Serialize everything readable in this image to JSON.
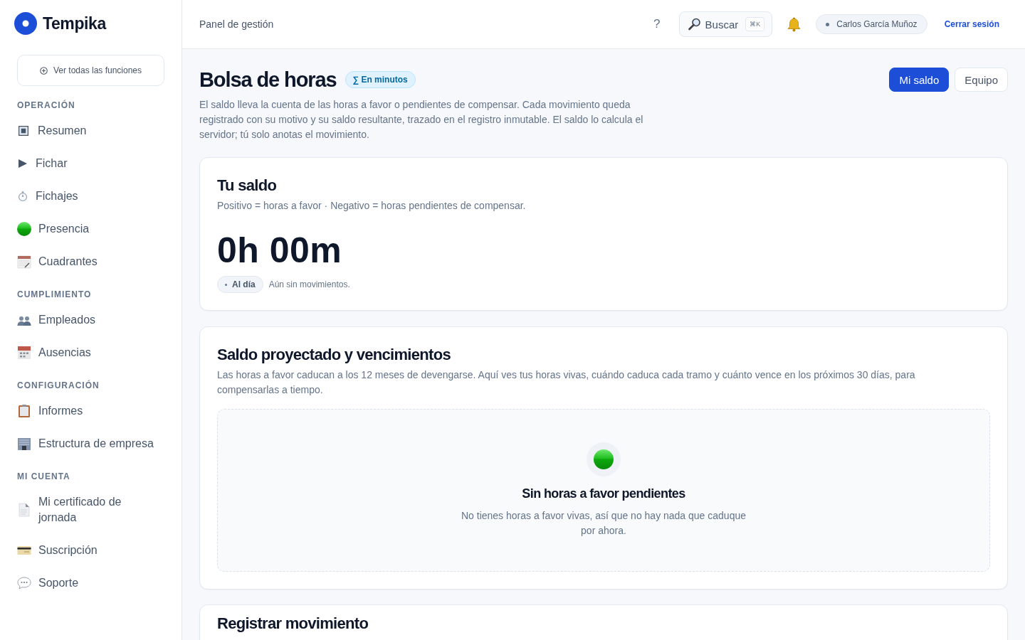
{
  "sidebar": {
    "brand": "Tempika",
    "all_features_button": "Ver todas las funciones",
    "sections": [
      {
        "title": "OPERACIÓN",
        "items": [
          {
            "label": "Resumen"
          },
          {
            "label": "Fichar"
          },
          {
            "label": "Fichajes"
          },
          {
            "label": "Presencia"
          },
          {
            "label": "Cuadrantes"
          }
        ]
      },
      {
        "title": "CUMPLIMIENTO",
        "items": [
          {
            "label": "Empleados"
          },
          {
            "label": "Ausencias"
          }
        ]
      },
      {
        "title": "CONFIGURACIÓN",
        "items": [
          {
            "label": "Informes"
          },
          {
            "label": "Estructura de empresa"
          }
        ]
      },
      {
        "title": "MI CUENTA",
        "items": [
          {
            "label": "Mi certificado de jornada"
          },
          {
            "label": "Suscripción"
          },
          {
            "label": "Soporte"
          }
        ]
      }
    ]
  },
  "header": {
    "breadcrumb": "Panel de gestión",
    "help_button": "?",
    "search": {
      "label": "Buscar",
      "shortcut": "⌘K"
    },
    "user": "Carlos García Muñoz",
    "logout_link": "Cerrar sesión"
  },
  "page": {
    "title": "Bolsa de horas",
    "unit_badge": "∑ En minutos",
    "description": "El saldo lleva la cuenta de las horas a favor o pendientes de compensar. Cada movimiento queda registrado con su motivo y su saldo resultante, trazado en el registro inmutable. El saldo lo calcula el servidor; tú solo anotas el movimiento.",
    "tabs": [
      {
        "label": "Mi saldo",
        "selected": true
      },
      {
        "label": "Equipo",
        "selected": false
      }
    ]
  },
  "balance_card": {
    "title": "Tu saldo",
    "subtitle": "Positivo = horas a favor · Negativo = horas pendientes de compensar.",
    "amount": "0h 00m",
    "status": "Al día",
    "note": "Aún sin movimientos."
  },
  "projection_card": {
    "title": "Saldo proyectado y vencimientos",
    "description": "Las horas a favor caducan a los 12 meses de devengarse. Aquí ves tus horas vivas, cuándo caduca cada tramo y cuánto vence en los próximos 30 días, para compensarlas a tiempo.",
    "empty_state": {
      "title": "Sin horas a favor pendientes",
      "message": "No tienes horas a favor vivas, así que no hay nada que caduque por ahora."
    }
  },
  "movement_card": {
    "title": "Registrar movimiento"
  }
}
